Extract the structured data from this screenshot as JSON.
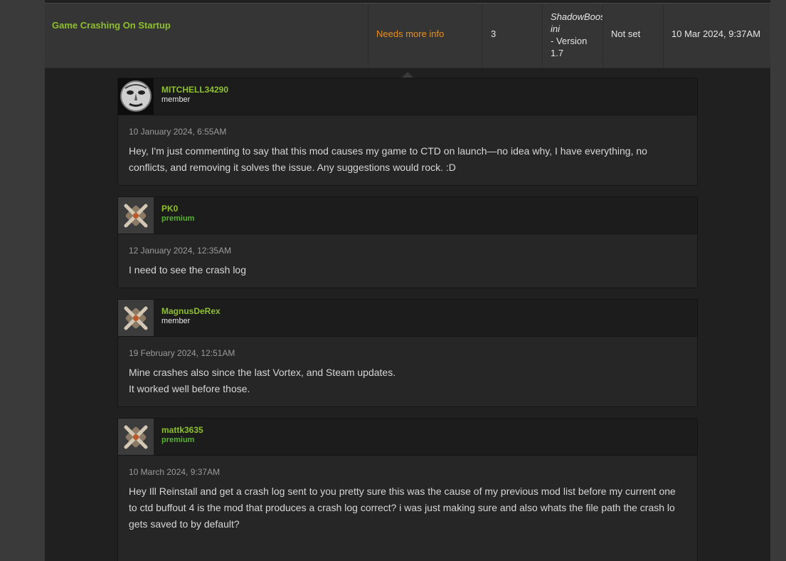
{
  "issue": {
    "title": "Game Crashing On Startup",
    "status": "Needs more info",
    "replies": "3",
    "version_file": "ShadowBoost.",
    "version_ext": "ini",
    "version_label": "- Version",
    "version_number": "1.7",
    "priority": "Not set",
    "last_post": "10 Mar 2024, 9:37AM"
  },
  "comments": [
    {
      "username": "MITCHELL34290",
      "role": "member",
      "date": "10 January 2024, 6:55AM",
      "text": "Hey, I'm just commenting to say that this mod causes my game to CTD on launch—no idea why, I have everything, no conflicts, and removing it solves the issue. Any suggestions would rock. :D"
    },
    {
      "username": "PK0",
      "role": "premium",
      "date": "12 January 2024, 12:35AM",
      "text": "I need to see the crash log"
    },
    {
      "username": "MagnusDeRex",
      "role": "member",
      "date": "19 February 2024, 12:51AM",
      "text_line1": "Mine crashes also since the last Vortex, and Steam updates.",
      "text_line2": "It worked well before those."
    },
    {
      "username": "mattk3635",
      "role": "premium",
      "date": "10 March 2024, 9:37AM",
      "text": "Hey Ill Reinstall and get a crash log sent to you pretty sure this was the cause of my previous mod list before my current one to ctd buffout 4 is the mod that produces a crash log correct? i was just making sure and also whats the file path the crash lo gets saved to by default?"
    }
  ]
}
